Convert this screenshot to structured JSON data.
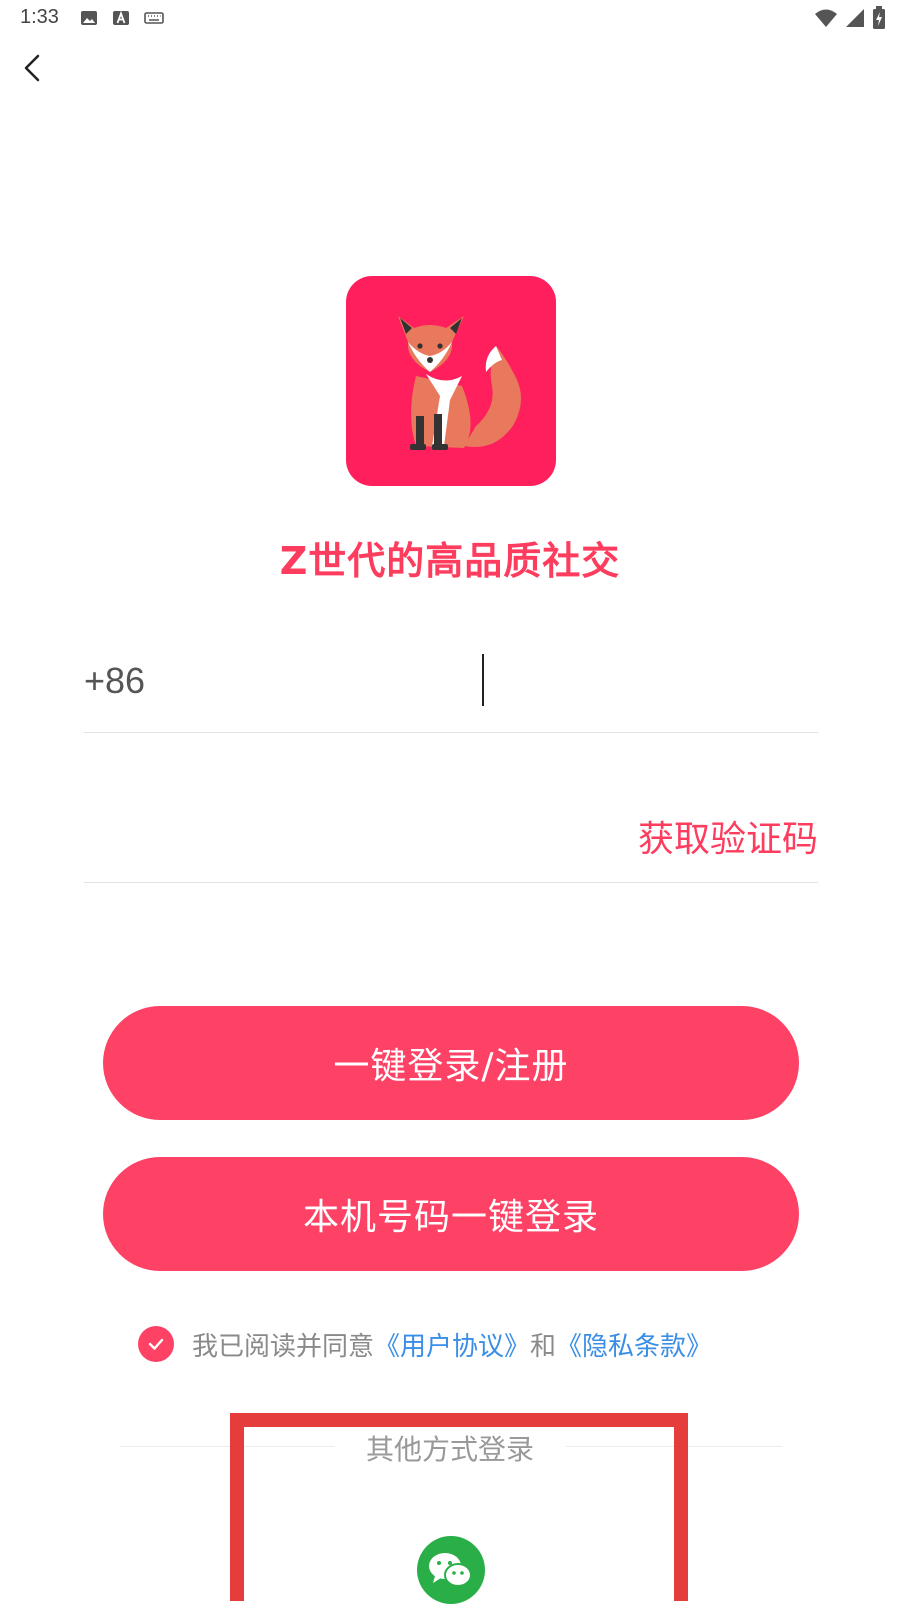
{
  "status_bar": {
    "time": "1:33",
    "icons_left": [
      "image-icon",
      "a-icon",
      "keyboard-icon"
    ],
    "icons_right": [
      "wifi-icon",
      "signal-icon",
      "battery-icon"
    ]
  },
  "nav": {
    "back_icon": "chevron-left-icon"
  },
  "brand": {
    "logo_icon": "fox-logo-icon",
    "slogan": "Z世代的高品质社交",
    "accent_color": "#fd4266"
  },
  "phone": {
    "country_code": "+86",
    "value": "",
    "placeholder": ""
  },
  "verification": {
    "value": "",
    "placeholder": "",
    "get_code_label": "获取验证码"
  },
  "buttons": {
    "login_register": "一键登录/注册",
    "local_number_login": "本机号码一键登录"
  },
  "agreement": {
    "checked": true,
    "prefix": "我已阅读并同意",
    "user_agreement": "《用户协议》",
    "conjunction": "和",
    "privacy_policy": "《隐私条款》"
  },
  "other_login": {
    "label": "其他方式登录",
    "options": [
      "wechat-icon"
    ]
  }
}
